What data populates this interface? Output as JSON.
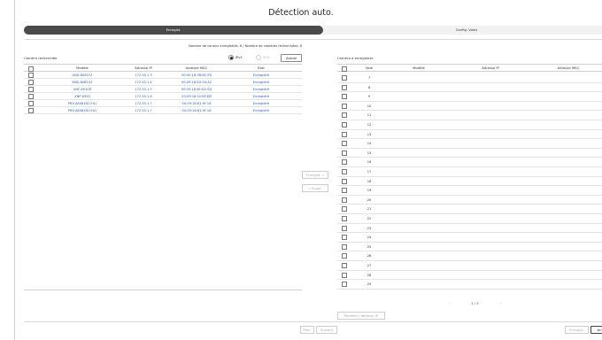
{
  "window": {
    "title": "Détection auto."
  },
  "tabs": [
    {
      "label": "Enregist."
    },
    {
      "label": "Config. Voies"
    }
  ],
  "search": {
    "count_text": "Nombre de canaux enregistrés: 6 / Nombre de caméras recherchées: 6",
    "section_label": "Caméra recherchée",
    "ipv4_label": "IPv4",
    "ipv6_label": "IPv6",
    "refresh_label": "Actual",
    "headers": [
      "Modèle",
      "Adresse IP",
      "Adresse MAC",
      "État"
    ],
    "rows": [
      {
        "model": "XND-6081FZ",
        "ip": "172.30.1.3",
        "mac": "00:09:18:5B:BC:F6",
        "state": "Enregistré"
      },
      {
        "model": "XND-8081VZ",
        "ip": "172.30.1.4",
        "mac": "00:09:18:5D:94:A2",
        "state": "Enregistré"
      },
      {
        "model": "XNF-8010R",
        "ip": "172.30.1.5",
        "mac": "00:09:18:4E:D2:0D",
        "state": "Enregistré"
      },
      {
        "model": "XNP-6320",
        "ip": "172.30.1.6",
        "mac": "00:09:18:52:8F:DB",
        "state": "Enregistré"
      },
      {
        "model": "PNV-A8081R(CH1)",
        "ip": "172.30.1.7",
        "mac": "00:09:18:61:9F:18",
        "state": "Enregistré"
      },
      {
        "model": "PNV-A8081R(CH2)",
        "ip": "172.30.1.7",
        "mac": "00:09:18:61:9F:18",
        "state": "Enregistré"
      }
    ]
  },
  "middle": {
    "register_label": "Enregist. »",
    "delete_label": "« Suppr."
  },
  "register": {
    "section_label": "Caméra à enregistrer",
    "headers": [
      "Voie",
      "Modèle",
      "Adresse IP",
      "Adresse MAC"
    ],
    "channels": [
      "7",
      "8",
      "9",
      "10",
      "11",
      "12",
      "13",
      "14",
      "15",
      "16",
      "17",
      "18",
      "19",
      "20",
      "21",
      "22",
      "23",
      "24",
      "25",
      "26",
      "27",
      "28",
      "29"
    ],
    "page_text": "1 / 3",
    "prev_arrow": "‹",
    "next_arrow": "›",
    "modify_ip_label": "Modifier l'adresse IP"
  },
  "footer": {
    "prev_label": "Préc.",
    "next_label": "Suivant",
    "register_label": "Enregist.",
    "cancel_label": "An"
  }
}
